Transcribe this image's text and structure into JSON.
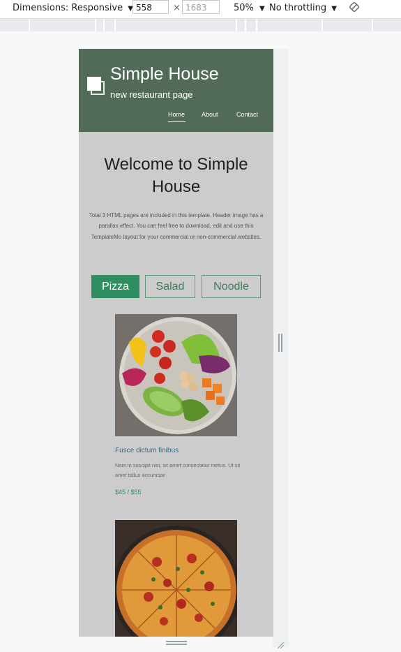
{
  "devtools": {
    "dimensions_label": "Dimensions: Responsive",
    "width_value": "558",
    "times_symbol": "×",
    "height_placeholder": "1683",
    "zoom_label": "50%",
    "throttling_label": "No throttling",
    "caret": "▼"
  },
  "site": {
    "title": "Simple House",
    "subtitle": "new restaurant page",
    "nav": [
      "Home",
      "About",
      "Contact"
    ]
  },
  "welcome": {
    "heading": "Welcome to Simple House",
    "text": "Total 3 HTML pages are included in this template. Header image has a parallax effect. You can feel free to download, edit and use this TemplateMo layout for your commercial or non-commercial websites."
  },
  "tabs": [
    "Pizza",
    "Salad",
    "Noodle"
  ],
  "items": [
    {
      "title": "Fusce dictum finibus",
      "desc": "Nam in suscipit nisi, sit amet consectetur metus. Ut sit amet tellus accumsan",
      "price": "$45 / $55"
    }
  ],
  "colors": {
    "header_bg": "#526b59",
    "content_bg": "#cccccc",
    "accent_green": "#2f8e5f",
    "link_blue": "#2c6e8f"
  }
}
